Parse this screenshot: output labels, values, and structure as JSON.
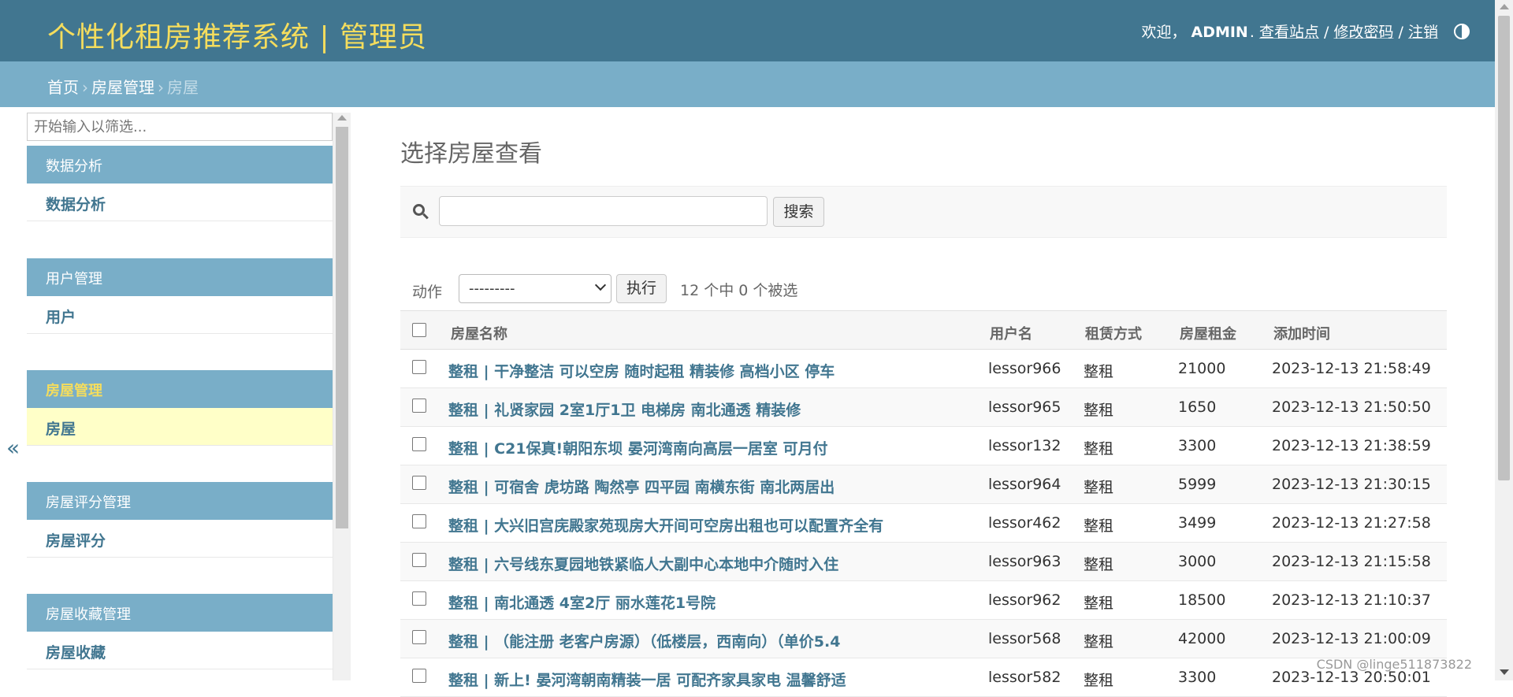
{
  "header": {
    "title": "个性化租房推荐系统 | 管理员",
    "welcome": "欢迎，",
    "username": "ADMIN",
    "links": [
      "查看站点",
      "修改密码",
      "注销"
    ],
    "theme_icon": "theme-toggle-icon"
  },
  "breadcrumbs": [
    "首页",
    "房屋管理",
    "房屋"
  ],
  "sidebar": {
    "filter_placeholder": "开始输入以筛选...",
    "collapse_symbol": "«",
    "modules": [
      {
        "caption": "数据分析",
        "item": "数据分析"
      },
      {
        "caption": "用户管理",
        "item": "用户"
      },
      {
        "caption": "房屋管理",
        "item": "房屋"
      },
      {
        "caption": "房屋评分管理",
        "item": "房屋评分"
      },
      {
        "caption": "房屋收藏管理",
        "item": "房屋收藏"
      }
    ]
  },
  "main": {
    "title": "选择房屋查看",
    "search_button": "搜索",
    "actions_label": "动作",
    "action_selected": "---------",
    "run_button": "执行",
    "selection_counter": "12 个中 0 个被选",
    "columns": [
      "房屋名称",
      "用户名",
      "租赁方式",
      "房屋租金",
      "添加时间"
    ],
    "rows": [
      {
        "name": "整租 | 干净整洁 可以空房 随时起租 精装修 高档小区 停车",
        "user": "lessor966",
        "type": "整租",
        "rent": "21000",
        "time": "2023-12-13 21:58:49"
      },
      {
        "name": "整租 | 礼贤家园 2室1厅1卫 电梯房 南北通透 精装修",
        "user": "lessor965",
        "type": "整租",
        "rent": "1650",
        "time": "2023-12-13 21:50:50"
      },
      {
        "name": "整租 | C21保真!朝阳东坝 晏河湾南向高层一居室 可月付",
        "user": "lessor132",
        "type": "整租",
        "rent": "3300",
        "time": "2023-12-13 21:38:59"
      },
      {
        "name": "整租 | 可宿舍 虎坊路 陶然亭 四平园 南横东街 南北两居出",
        "user": "lessor964",
        "type": "整租",
        "rent": "5999",
        "time": "2023-12-13 21:30:15"
      },
      {
        "name": "整租 | 大兴旧宫庑殿家苑现房大开间可空房出租也可以配置齐全有",
        "user": "lessor462",
        "type": "整租",
        "rent": "3499",
        "time": "2023-12-13 21:27:58"
      },
      {
        "name": "整租 | 六号线东夏园地铁紧临人大副中心本地中介随时入住",
        "user": "lessor963",
        "type": "整租",
        "rent": "3000",
        "time": "2023-12-13 21:15:58"
      },
      {
        "name": "整租 | 南北通透 4室2厅 丽水莲花1号院",
        "user": "lessor962",
        "type": "整租",
        "rent": "18500",
        "time": "2023-12-13 21:10:37"
      },
      {
        "name": "整租 | （能注册 老客户房源）（低楼层，西南向）（单价5.4",
        "user": "lessor568",
        "type": "整租",
        "rent": "42000",
        "time": "2023-12-13 21:00:09"
      },
      {
        "name": "整租 | 新上! 晏河湾朝南精装一居 可配齐家具家电 温馨舒适",
        "user": "lessor582",
        "type": "整租",
        "rent": "3300",
        "time": "2023-12-13 20:50:01"
      }
    ]
  },
  "watermark": "CSDN @linge511873822",
  "colors": {
    "header_bg": "#417690",
    "brand_text": "#f5dd5d",
    "breadcrumb_bg": "#79aec8",
    "link": "#417690",
    "current_row_bg": "#ffffc8"
  }
}
